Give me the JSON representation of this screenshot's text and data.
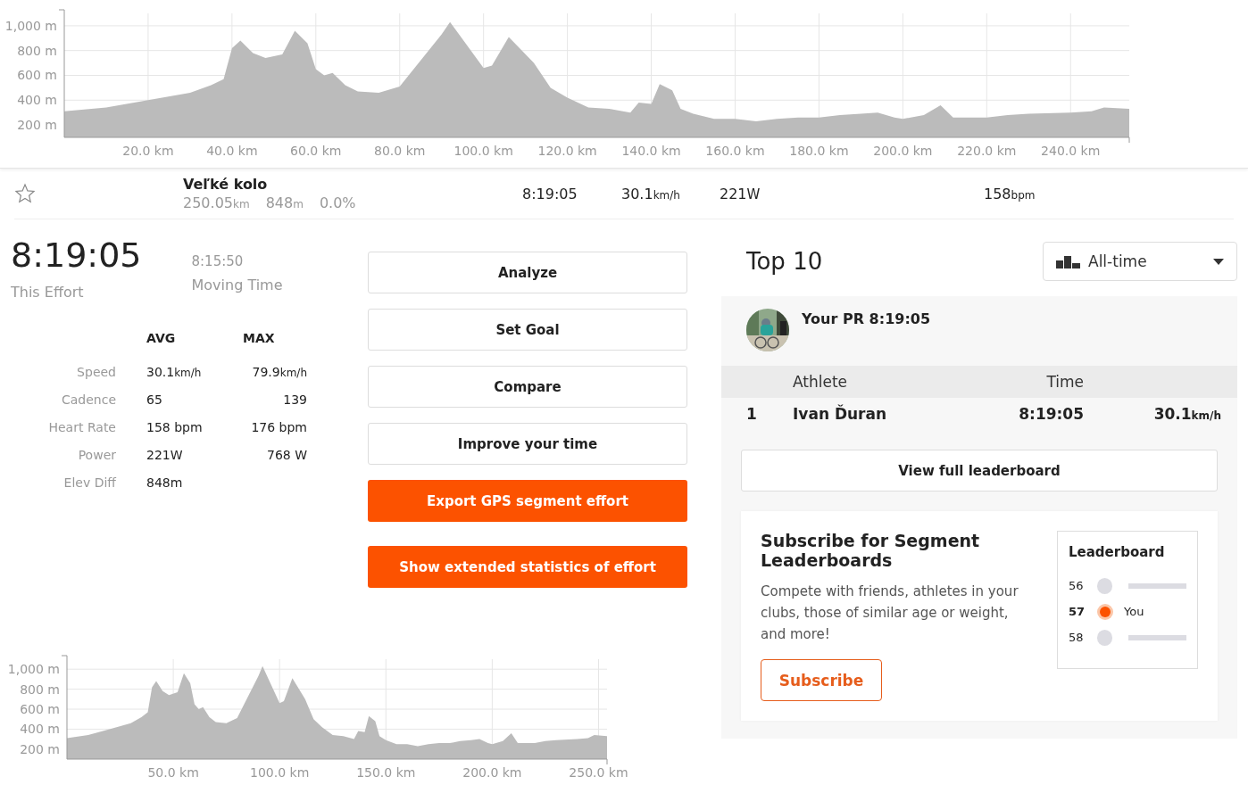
{
  "elevation_chart": {
    "chart_data": {
      "type": "area",
      "grid": true,
      "xlim": [
        0,
        254
      ],
      "ylim": [
        100,
        1100
      ],
      "yticks": [
        {
          "value": 200,
          "label": "200 m"
        },
        {
          "value": 400,
          "label": "400 m"
        },
        {
          "value": 600,
          "label": "600 m"
        },
        {
          "value": 800,
          "label": "800 m"
        },
        {
          "value": 1000,
          "label": "1,000 m"
        }
      ],
      "xticks": [
        {
          "value": 20,
          "label": "20.0 km"
        },
        {
          "value": 40,
          "label": "40.0 km"
        },
        {
          "value": 60,
          "label": "60.0 km"
        },
        {
          "value": 80,
          "label": "80.0 km"
        },
        {
          "value": 100,
          "label": "100.0 km"
        },
        {
          "value": 120,
          "label": "120.0 km"
        },
        {
          "value": 140,
          "label": "140.0 km"
        },
        {
          "value": 160,
          "label": "160.0 km"
        },
        {
          "value": 180,
          "label": "180.0 km"
        },
        {
          "value": 200,
          "label": "200.0 km"
        },
        {
          "value": 220,
          "label": "220.0 km"
        },
        {
          "value": 240,
          "label": "240.0 km"
        }
      ],
      "x": [
        0,
        10,
        20,
        30,
        35,
        38,
        40,
        42,
        45,
        48,
        52,
        55,
        58,
        60,
        62,
        64,
        67,
        70,
        75,
        80,
        85,
        90,
        92,
        100,
        102,
        106,
        112,
        116,
        120,
        125,
        130,
        135,
        137,
        140,
        142,
        145,
        147,
        150,
        155,
        160,
        165,
        170,
        175,
        180,
        185,
        190,
        194,
        198,
        200,
        205,
        209,
        212,
        220,
        225,
        230,
        240,
        245,
        248,
        254
      ],
      "series": [
        {
          "color": "#bbbbbb",
          "values": [
            310,
            340,
            400,
            460,
            520,
            570,
            820,
            880,
            780,
            740,
            770,
            960,
            860,
            650,
            600,
            620,
            520,
            470,
            460,
            510,
            720,
            930,
            1030,
            660,
            680,
            910,
            700,
            500,
            420,
            340,
            330,
            300,
            380,
            370,
            530,
            480,
            330,
            290,
            250,
            250,
            230,
            250,
            260,
            260,
            280,
            290,
            300,
            260,
            250,
            280,
            360,
            260,
            260,
            280,
            290,
            300,
            310,
            340,
            330
          ]
        }
      ]
    }
  },
  "segment": {
    "name": "Veľké kolo",
    "distance": "250.05",
    "distance_unit": "km",
    "elevation": "848",
    "elevation_unit": "m",
    "grade": "0.0%",
    "time": "8:19:05",
    "speed": "30.1",
    "speed_unit": "km/h",
    "power": "221",
    "power_unit": "W",
    "heart_rate": "158",
    "heart_rate_unit": "bpm"
  },
  "effort": {
    "time": "8:19:05",
    "time_label": "This Effort",
    "moving_time": "8:15:50",
    "moving_label": "Moving Time"
  },
  "stats": {
    "columns": [
      "AVG",
      "MAX"
    ],
    "rows": [
      {
        "label": "Speed",
        "avg": "30.1",
        "avg_unit": "km/h",
        "max": "79.9",
        "max_unit": "km/h"
      },
      {
        "label": "Cadence",
        "avg": "65",
        "max": "139"
      },
      {
        "label": "Heart Rate",
        "avg": "158 bpm",
        "max": "176 bpm"
      },
      {
        "label": "Power",
        "avg": "221W",
        "max": "768 W"
      },
      {
        "label": "Elev Diff",
        "avg": "848m"
      }
    ]
  },
  "actions": [
    {
      "label": "Analyze",
      "kind": "outline"
    },
    {
      "label": "Set Goal",
      "kind": "outline"
    },
    {
      "label": "Compare",
      "kind": "outline"
    },
    {
      "label": "Improve your time",
      "kind": "outline"
    },
    {
      "label": "Export GPS segment effort",
      "kind": "primary"
    },
    {
      "label": "Show extended statistics of effort",
      "kind": "primary"
    }
  ],
  "leaderboard": {
    "title": "Top 10",
    "filter": "All-time",
    "pr_label": "Your PR",
    "pr_time": "8:19:05",
    "columns": [
      "Athlete",
      "Time"
    ],
    "rows": [
      {
        "rank": "1",
        "athlete": "Ivan Ďuran",
        "time": "8:19:05",
        "speed": "30.1",
        "speed_unit": "km/h"
      }
    ],
    "view_button": "View full leaderboard"
  },
  "subscribe": {
    "title": "Subscribe for Segment Leaderboards",
    "text": "Compete with friends, athletes in your clubs, those of similar age or weight, and more!",
    "button": "Subscribe",
    "preview_title": "Leaderboard",
    "preview_rows": [
      {
        "rank": "56",
        "selected": false
      },
      {
        "rank": "57",
        "selected": true,
        "label": "You"
      },
      {
        "rank": "58",
        "selected": false
      }
    ]
  },
  "small_elevation_chart": {
    "chart_data": {
      "type": "area",
      "grid": true,
      "xlim": [
        0,
        254
      ],
      "ylim": [
        100,
        1100
      ],
      "yticks": [
        {
          "value": 200,
          "label": "200 m"
        },
        {
          "value": 400,
          "label": "400 m"
        },
        {
          "value": 600,
          "label": "600 m"
        },
        {
          "value": 800,
          "label": "800 m"
        },
        {
          "value": 1000,
          "label": "1,000 m"
        }
      ],
      "xticks": [
        {
          "value": 50,
          "label": "50.0 km"
        },
        {
          "value": 100,
          "label": "100.0 km"
        },
        {
          "value": 150,
          "label": "150.0 km"
        },
        {
          "value": 200,
          "label": "200.0 km"
        },
        {
          "value": 250,
          "label": "250.0 km"
        }
      ],
      "x": [
        0,
        10,
        20,
        30,
        35,
        38,
        40,
        42,
        45,
        48,
        52,
        55,
        58,
        60,
        62,
        64,
        67,
        70,
        75,
        80,
        85,
        90,
        92,
        100,
        102,
        106,
        112,
        116,
        120,
        125,
        130,
        135,
        137,
        140,
        142,
        145,
        147,
        150,
        155,
        160,
        165,
        170,
        175,
        180,
        185,
        190,
        194,
        198,
        200,
        205,
        209,
        212,
        220,
        225,
        230,
        240,
        245,
        248,
        254
      ],
      "series": [
        {
          "color": "#bbbbbb",
          "values": [
            310,
            340,
            400,
            460,
            520,
            570,
            820,
            880,
            780,
            740,
            770,
            960,
            860,
            650,
            600,
            620,
            520,
            470,
            460,
            510,
            720,
            930,
            1030,
            660,
            680,
            910,
            700,
            500,
            420,
            340,
            330,
            300,
            380,
            370,
            530,
            480,
            330,
            290,
            250,
            250,
            230,
            250,
            260,
            260,
            280,
            290,
            300,
            260,
            250,
            280,
            360,
            260,
            260,
            280,
            290,
            300,
            310,
            340,
            330
          ]
        }
      ]
    }
  }
}
